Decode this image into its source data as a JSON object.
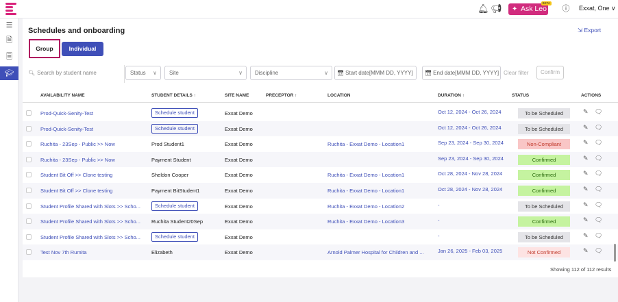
{
  "header": {
    "ask_leo": "Ask Leo",
    "beta": "BETA",
    "user_name": "Exxat, One"
  },
  "page": {
    "title": "Schedules and onboarding",
    "export_label": "Export"
  },
  "tabs": [
    {
      "label": "Group",
      "active": true
    },
    {
      "label": "Individual",
      "active": false
    }
  ],
  "filters": {
    "search_placeholder": "Search by student name",
    "status": "Status",
    "site": "Site",
    "discipline": "Discipline",
    "start_date": "Start date[MMM DD, YYYY]",
    "end_date": "End date[MMM DD, YYYY]",
    "clear_filter": "Clear filter",
    "confirm": "Confirm"
  },
  "table": {
    "columns": [
      "AVAILABILITY NAME",
      "STUDENT DETAILS",
      "SITE NAME",
      "PRECEPTOR",
      "LOCATION",
      "DURATION",
      "STATUS",
      "ACTIONS"
    ],
    "rows": [
      {
        "name": "Prod-Quick-Senity-Test",
        "student": "Schedule student",
        "student_is_button": true,
        "site": "Exxat Demo",
        "location": "",
        "duration": "Oct 12, 2024 - Oct 26, 2024",
        "status": "To be Scheduled",
        "status_type": "sch"
      },
      {
        "name": "Prod-Quick-Senity-Test",
        "student": "Schedule student",
        "student_is_button": true,
        "site": "Exxat Demo",
        "location": "",
        "duration": "Oct 12, 2024 - Oct 26, 2024",
        "status": "To be Scheduled",
        "status_type": "sch"
      },
      {
        "name": "Ruchita - 23Sep - Public >> Now",
        "student": "Prod Student1",
        "student_is_button": false,
        "site": "Exxat Demo",
        "location": "Ruchita - Exxat Demo - Location1",
        "duration": "Sep 23, 2024 - Sep 30, 2024",
        "status": "Non-Compliant",
        "status_type": "nc"
      },
      {
        "name": "Ruchita - 23Sep - Public >> Now",
        "student": "Payment Student",
        "student_is_button": false,
        "site": "Exxat Demo",
        "location": "",
        "duration": "Sep 23, 2024 - Sep 30, 2024",
        "status": "Confirmed",
        "status_type": "conf"
      },
      {
        "name": "Student Bit Off >> Clone testing",
        "student": "Sheldon Cooper",
        "student_is_button": false,
        "site": "Exxat Demo",
        "location": "Ruchita - Exxat Demo - Location1",
        "duration": "Oct 28, 2024 - Nov 28, 2024",
        "status": "Confirmed",
        "status_type": "conf"
      },
      {
        "name": "Student Bit Off >> Clone testing",
        "student": "Payment BitStudent1",
        "student_is_button": false,
        "site": "Exxat Demo",
        "location": "Ruchita - Exxat Demo - Location1",
        "duration": "Oct 28, 2024 - Nov 28, 2024",
        "status": "Confirmed",
        "status_type": "conf"
      },
      {
        "name": "Student Profile Shared with Slots >> Scho...",
        "student": "Schedule student",
        "student_is_button": true,
        "site": "Exxat Demo",
        "location": "Ruchita - Exxat Demo - Location2",
        "duration": "-",
        "status": "To be Scheduled",
        "status_type": "sch"
      },
      {
        "name": "Student Profile Shared with Slots >> Scho...",
        "student": "Ruchita Student20Sep",
        "student_is_button": false,
        "site": "Exxat Demo",
        "location": "Ruchita - Exxat Demo - Location3",
        "duration": "-",
        "status": "Confirmed",
        "status_type": "conf"
      },
      {
        "name": "Student Profile Shared with Slots >> Scho...",
        "student": "Schedule student",
        "student_is_button": true,
        "site": "Exxat Demo",
        "location": "",
        "duration": "-",
        "status": "To be Scheduled",
        "status_type": "sch"
      },
      {
        "name": "Test Nov 7th Rumita",
        "student": "Elizabeth",
        "student_is_button": false,
        "site": "Exxat Demo",
        "location": "Arnold Palmer Hospital for Children and ...",
        "duration": "Jan 26, 2025 - Feb 03, 2025",
        "status": "Not Confirmed",
        "status_type": "nconf"
      }
    ]
  },
  "footer": {
    "showing": "Showing 112 of 112 results"
  }
}
